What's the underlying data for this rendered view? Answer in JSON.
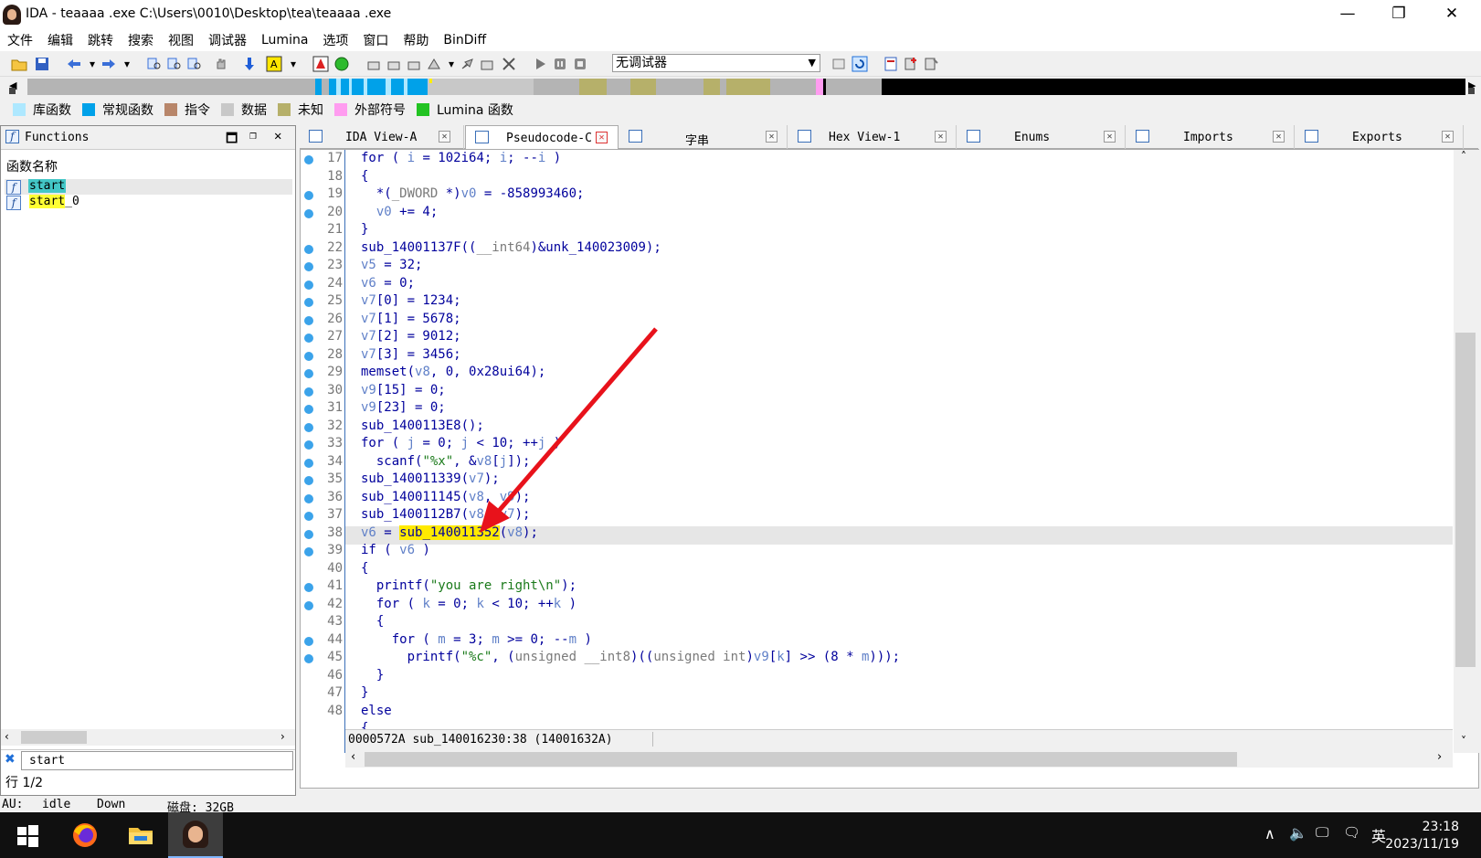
{
  "window": {
    "title": "IDA - teaaaa .exe C:\\Users\\0010\\Desktop\\tea\\teaaaa .exe",
    "minimize_glyph": "—",
    "maximize_glyph": "❐",
    "close_glyph": "✕"
  },
  "menu": [
    "文件",
    "编辑",
    "跳转",
    "搜索",
    "视图",
    "调试器",
    "Lumina",
    "选项",
    "窗口",
    "帮助",
    "BinDiff"
  ],
  "toolbar": {
    "debugger_select": "无调试器"
  },
  "legend": [
    {
      "label": "库函数",
      "color": "#aee8ff"
    },
    {
      "label": "常规函数",
      "color": "#00a1e9"
    },
    {
      "label": "指令",
      "color": "#b8866a"
    },
    {
      "label": "数据",
      "color": "#c8c8c8"
    },
    {
      "label": "未知",
      "color": "#b6b06a"
    },
    {
      "label": "外部符号",
      "color": "#ff9cf0"
    },
    {
      "label": "Lumina 函数",
      "color": "#22c322"
    }
  ],
  "functions_panel": {
    "title": "Functions",
    "column_header": "函数名称",
    "items": [
      {
        "name": "start",
        "highlight": "#43c7c7"
      },
      {
        "name": "start",
        "suffix": "_0",
        "highlight": "#ffff33"
      }
    ],
    "filter_value": "start",
    "row_count": "行 1/2"
  },
  "tabs": [
    {
      "label": "IDA View-A",
      "icon": "disassembly-icon"
    },
    {
      "label": "Pseudocode-C",
      "icon": "pseudocode-icon",
      "active": true
    },
    {
      "label": "字串",
      "icon": "strings-icon"
    },
    {
      "label": "Hex View-1",
      "icon": "hex-icon"
    },
    {
      "label": "Enums",
      "icon": "enums-icon"
    },
    {
      "label": "Imports",
      "icon": "imports-icon"
    },
    {
      "label": "Exports",
      "icon": "exports-icon"
    }
  ],
  "code": {
    "lines": [
      {
        "n": "17",
        "dot": true,
        "html": "for ( <span class='v'>i</span> = 102i64; <span class='v'>i</span>; --<span class='v'>i</span> )"
      },
      {
        "n": "18",
        "dot": false,
        "html": "{"
      },
      {
        "n": "19",
        "dot": true,
        "html": "  *(<span class='g'>_DWORD</span> *)<span class='v'>v0</span> = -858993460;"
      },
      {
        "n": "20",
        "dot": true,
        "html": "  <span class='v'>v0</span> += 4;"
      },
      {
        "n": "21",
        "dot": false,
        "html": "}"
      },
      {
        "n": "22",
        "dot": true,
        "html": "sub_14001137F((<span class='g'>__int64</span>)&amp;unk_140023009);"
      },
      {
        "n": "23",
        "dot": true,
        "html": "<span class='v'>v5</span> = 32;"
      },
      {
        "n": "24",
        "dot": true,
        "html": "<span class='v'>v6</span> = 0;"
      },
      {
        "n": "25",
        "dot": true,
        "html": "<span class='v'>v7</span>[0] = 1234;"
      },
      {
        "n": "26",
        "dot": true,
        "html": "<span class='v'>v7</span>[1] = 5678;"
      },
      {
        "n": "27",
        "dot": true,
        "html": "<span class='v'>v7</span>[2] = 9012;"
      },
      {
        "n": "28",
        "dot": true,
        "html": "<span class='v'>v7</span>[3] = 3456;"
      },
      {
        "n": "29",
        "dot": true,
        "html": "memset(<span class='v'>v8</span>, 0, 0x28ui64);"
      },
      {
        "n": "30",
        "dot": true,
        "html": "<span class='v'>v9</span>[15] = 0;"
      },
      {
        "n": "31",
        "dot": true,
        "html": "<span class='v'>v9</span>[23] = 0;"
      },
      {
        "n": "32",
        "dot": true,
        "html": "sub_1400113E8();"
      },
      {
        "n": "33",
        "dot": true,
        "html": "for ( <span class='v'>j</span> = 0; <span class='v'>j</span> &lt; 10; ++<span class='v'>j</span> )"
      },
      {
        "n": "34",
        "dot": true,
        "html": "  scanf(<span class='s'>\"%x\"</span>, &amp;<span class='v'>v8</span>[<span class='v'>j</span>]);"
      },
      {
        "n": "35",
        "dot": true,
        "html": "sub_140011339(<span class='v'>v7</span>);"
      },
      {
        "n": "36",
        "dot": true,
        "html": "sub_140011145(<span class='v'>v8</span>, <span class='v'>v9</span>);"
      },
      {
        "n": "37",
        "dot": true,
        "html": "sub_1400112B7(<span class='v'>v8</span>, <span class='v'>v7</span>);"
      },
      {
        "n": "38",
        "dot": true,
        "html": "<span class='v'>v6</span> = <span style='background:#ffea00'>sub_140011352</span>(<span class='v'>v8</span>);"
      },
      {
        "n": "39",
        "dot": true,
        "html": "if ( <span class='v'>v6</span> )"
      },
      {
        "n": "40",
        "dot": false,
        "html": "{"
      },
      {
        "n": "41",
        "dot": true,
        "html": "  printf(<span class='s'>\"you are right\\n\"</span>);"
      },
      {
        "n": "42",
        "dot": true,
        "html": "  for ( <span class='v'>k</span> = 0; <span class='v'>k</span> &lt; 10; ++<span class='v'>k</span> )"
      },
      {
        "n": "43",
        "dot": false,
        "html": "  {"
      },
      {
        "n": "44",
        "dot": true,
        "html": "    for ( <span class='v'>m</span> = 3; <span class='v'>m</span> &gt;= 0; --<span class='v'>m</span> )"
      },
      {
        "n": "45",
        "dot": true,
        "html": "      printf(<span class='s'>\"%c\"</span>, (<span class='g'>unsigned __int8</span>)((<span class='g'>unsigned int</span>)<span class='v'>v9</span>[<span class='v'>k</span>] &gt;&gt; (8 * <span class='v'>m</span>)));"
      },
      {
        "n": "46",
        "dot": false,
        "html": "  }"
      },
      {
        "n": "47",
        "dot": false,
        "html": "}"
      },
      {
        "n": "48",
        "dot": false,
        "html": "else"
      },
      {
        "n": "",
        "dot": false,
        "html": "{"
      }
    ],
    "status_info": "0000572A sub_140016230:38 (14001632A)"
  },
  "status": {
    "au_label": "AU:",
    "au_state": "idle",
    "direction": "Down",
    "disk": "磁盘: 32GB"
  },
  "taskbar": {
    "time": "23:18",
    "date": "2023/11/19",
    "ime": "英"
  }
}
